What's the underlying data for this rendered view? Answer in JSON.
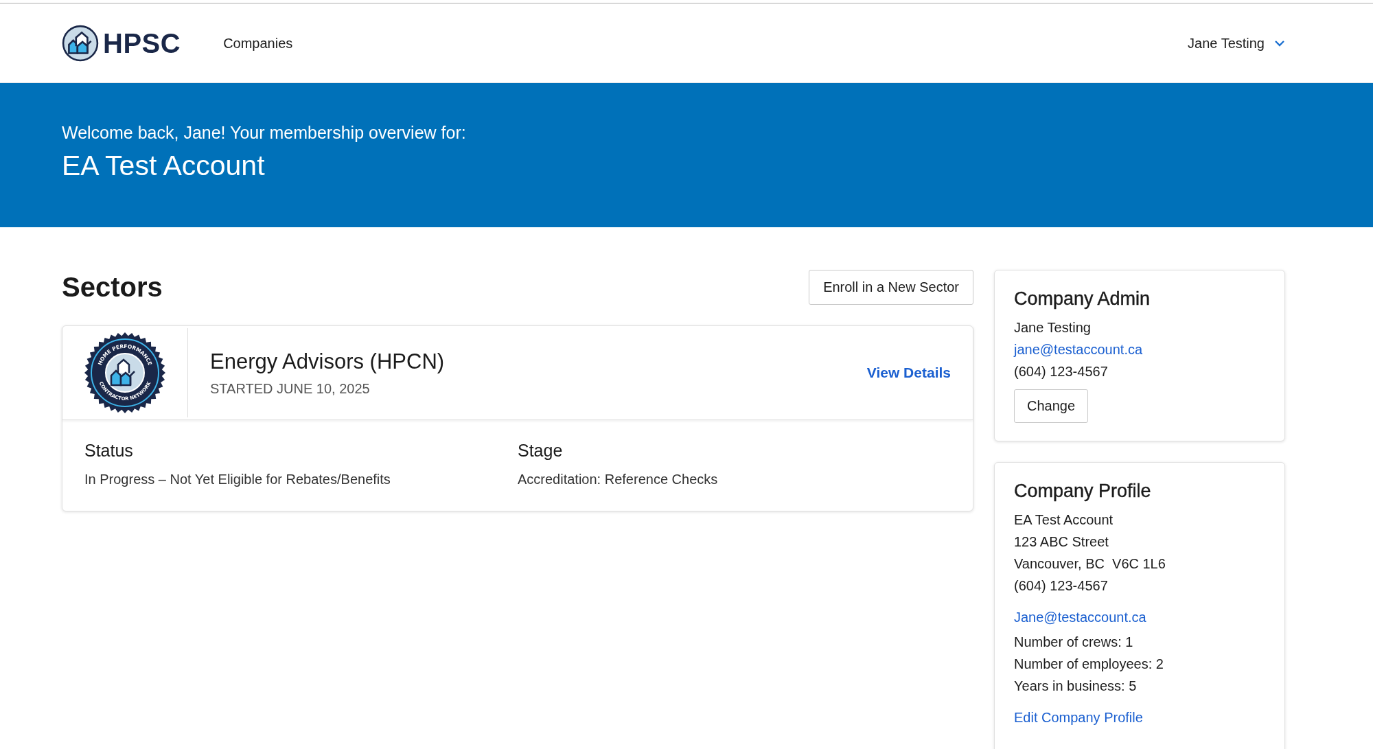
{
  "header": {
    "logo_text": "HPSC",
    "nav": [
      {
        "label": "Companies"
      }
    ],
    "user": "Jane Testing"
  },
  "banner": {
    "greeting": "Welcome back, Jane! Your membership overview for:",
    "account": "EA Test Account"
  },
  "sectors": {
    "title": "Sectors",
    "enroll_button": "Enroll in a New Sector",
    "items": [
      {
        "badge_top": "HOME PERFORMANCE",
        "badge_bottom": "CONTRACTOR NETWORK",
        "name": "Energy Advisors (HPCN)",
        "started": "STARTED JUNE 10, 2025",
        "link": "View Details",
        "status_label": "Status",
        "status": "In Progress – Not Yet Eligible for Rebates/Benefits",
        "stage_label": "Stage",
        "stage": "Accreditation: Reference Checks"
      }
    ]
  },
  "company_admin": {
    "title": "Company Admin",
    "name": "Jane Testing",
    "email": "jane@testaccount.ca",
    "phone": "(604) 123-4567",
    "button": "Change"
  },
  "company_profile": {
    "title": "Company Profile",
    "address": [
      "EA Test Account",
      "123 ABC Street",
      "Vancouver, BC  V6C 1L6",
      "(604) 123-4567"
    ],
    "email": "Jane@testaccount.ca",
    "facts": [
      "Number of crews: 1",
      "Number of employees: 2",
      "Years in business: 5"
    ],
    "link": "Edit Company Profile"
  }
}
